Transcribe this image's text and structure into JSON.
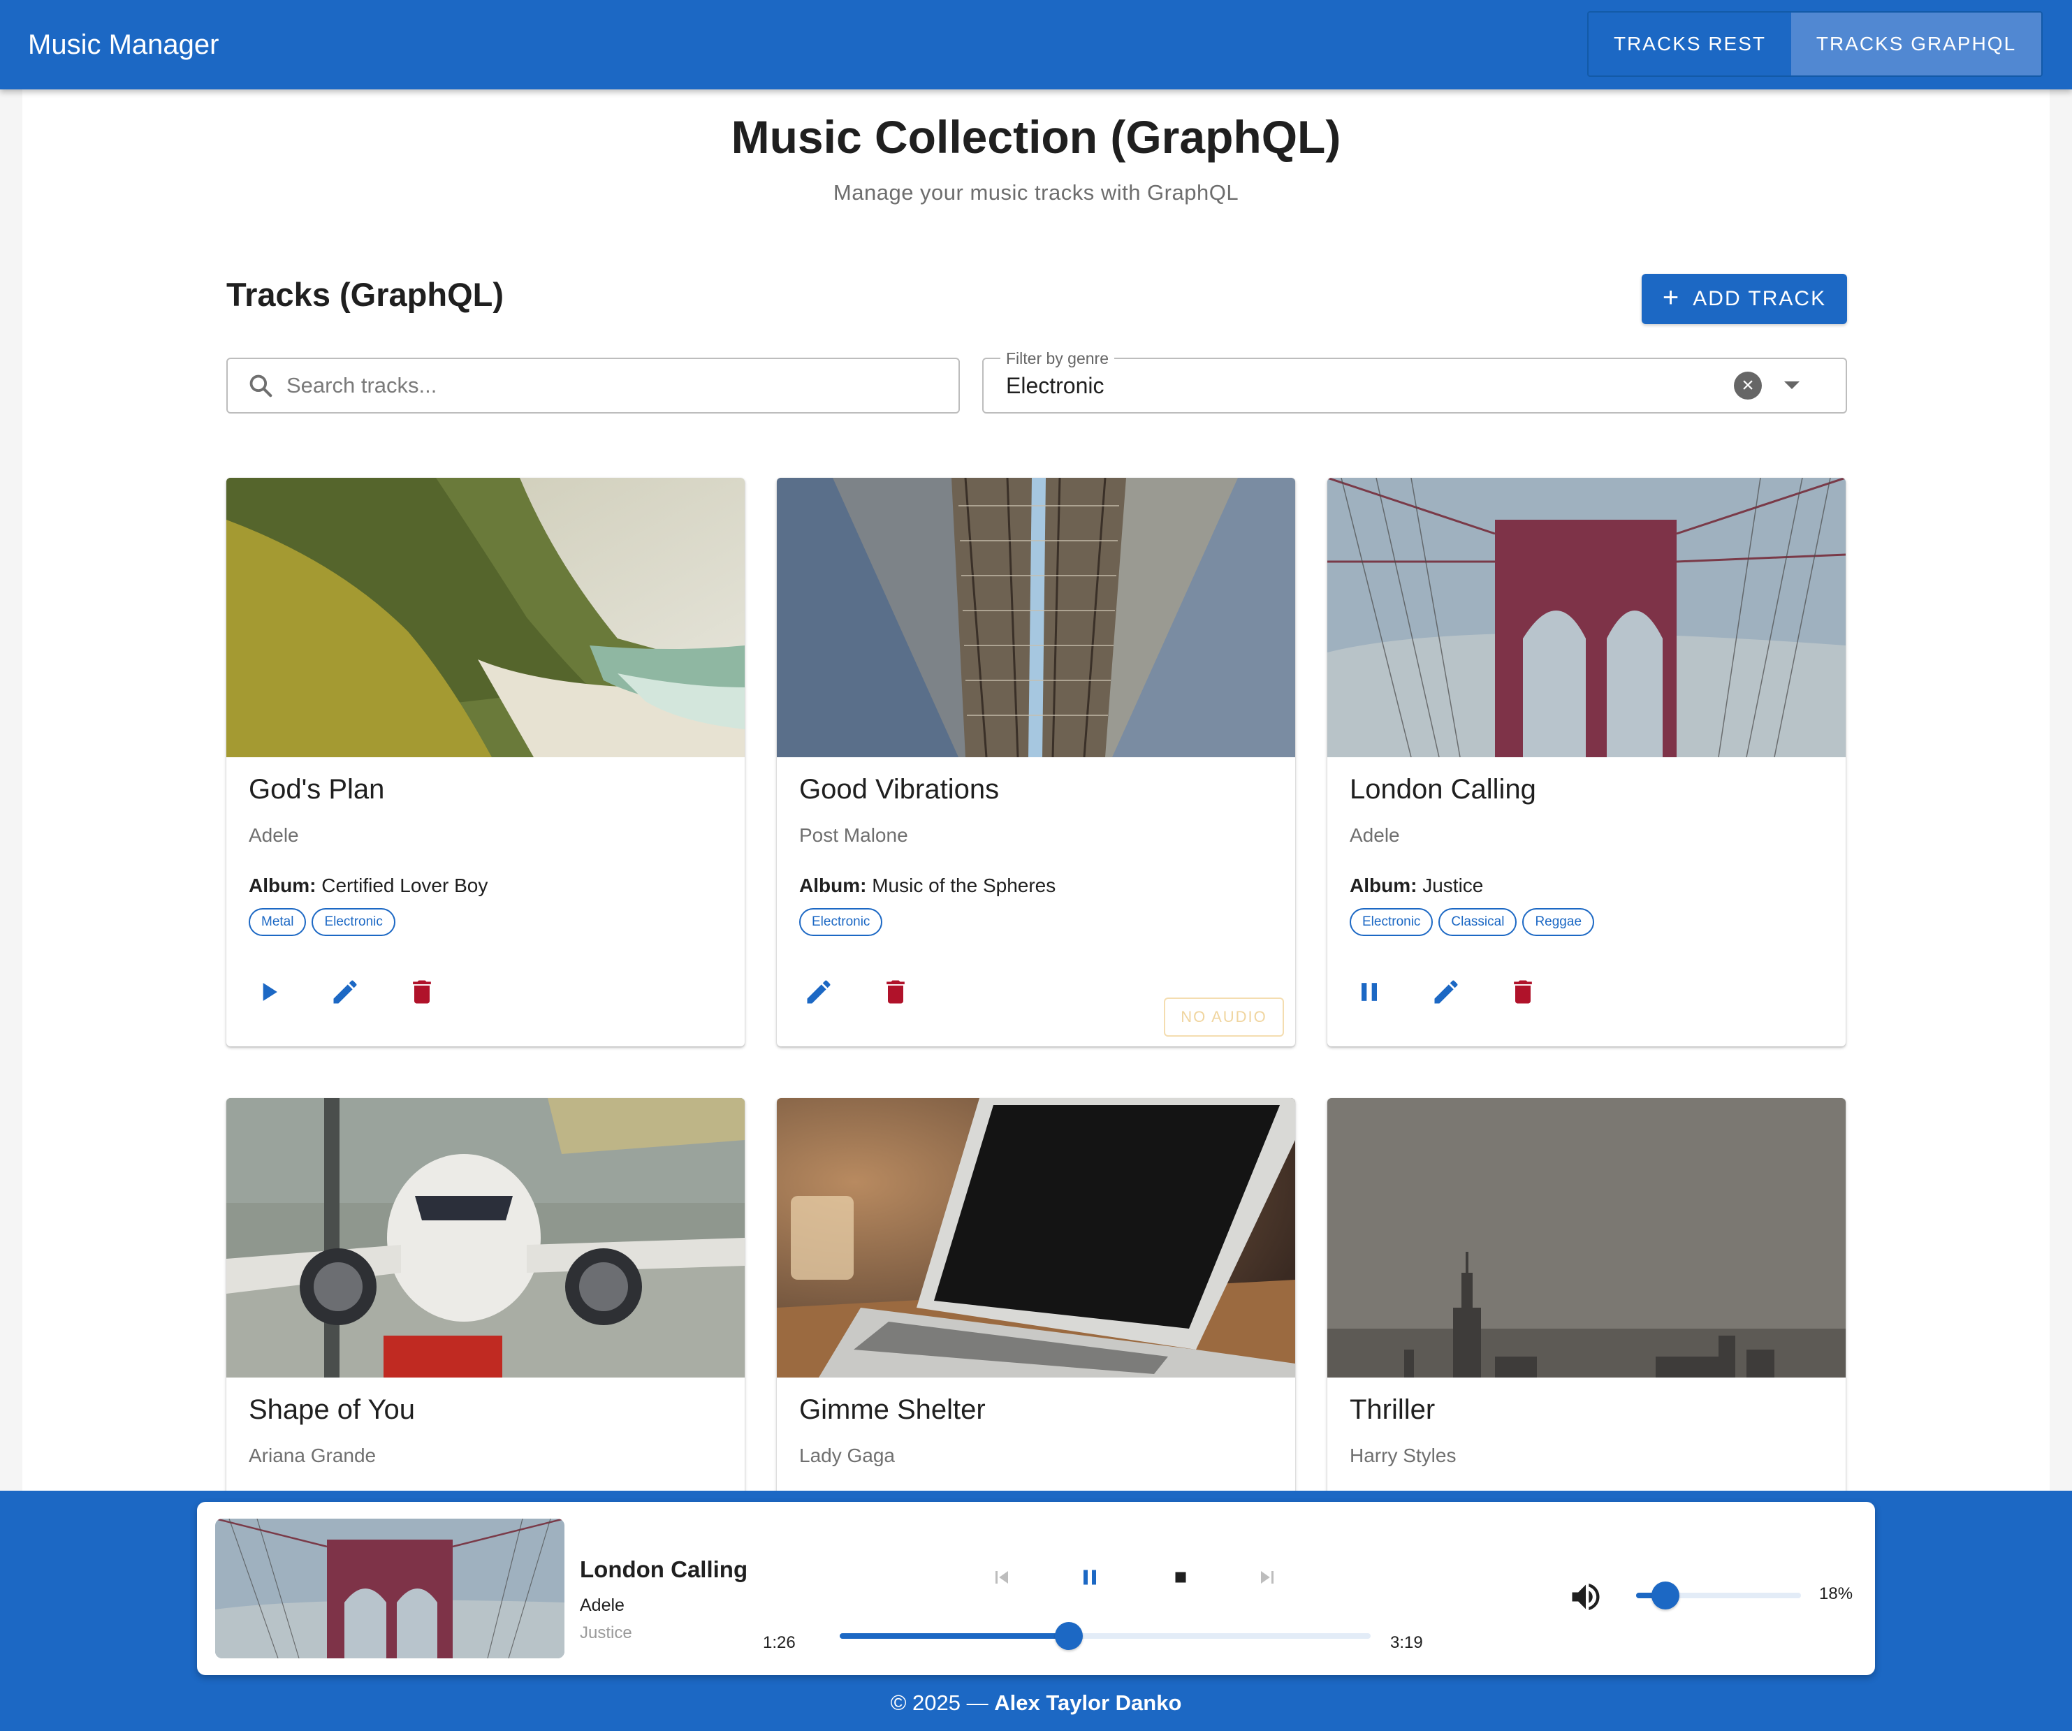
{
  "app": {
    "title": "Music Manager"
  },
  "nav": {
    "rest_label": "TRACKS REST",
    "graphql_label": "TRACKS GRAPHQL",
    "active": "graphql"
  },
  "header": {
    "title": "Music Collection (GraphQL)",
    "subtitle": "Manage your music tracks with GraphQL"
  },
  "section": {
    "title": "Tracks (GraphQL)",
    "add_label": "ADD TRACK",
    "add_icon": "plus-icon"
  },
  "search": {
    "placeholder": "Search tracks...",
    "value": "",
    "icon": "search-icon"
  },
  "genre_filter": {
    "label": "Filter by genre",
    "value": "Electronic"
  },
  "colors": {
    "primary": "#1c68c4",
    "danger": "#b0122a",
    "active_nav": "#5188d2",
    "no_audio": "#f0d59f"
  },
  "album_prefix": "Album:",
  "tracks": [
    {
      "title": "God's Plan",
      "artist": "Adele",
      "album": "Certified Lover Boy",
      "genres": [
        "Metal",
        "Electronic"
      ],
      "state": "play",
      "image": "coastal-cliff"
    },
    {
      "title": "Good Vibrations",
      "artist": "Post Malone",
      "album": "Music of the Spheres",
      "genres": [
        "Electronic"
      ],
      "state": "no-audio",
      "no_audio_label": "NO AUDIO",
      "image": "railway-tracks"
    },
    {
      "title": "London Calling",
      "artist": "Adele",
      "album": "Justice",
      "genres": [
        "Electronic",
        "Classical",
        "Reggae"
      ],
      "state": "pause",
      "image": "bridge-cables"
    },
    {
      "title": "Shape of You",
      "artist": "Ariana Grande",
      "image": "airplane"
    },
    {
      "title": "Gimme Shelter",
      "artist": "Lady Gaga",
      "image": "laptop"
    },
    {
      "title": "Thriller",
      "artist": "Harry Styles",
      "image": "city-skyline"
    }
  ],
  "player": {
    "title": "London Calling",
    "artist": "Adele",
    "album": "Justice",
    "elapsed": "1:26",
    "duration": "3:19",
    "progress_fraction": 0.432,
    "volume_percent": 18,
    "volume_label": "18%"
  },
  "footer": {
    "prefix": "© 2025 — ",
    "author": "Alex Taylor Danko"
  }
}
